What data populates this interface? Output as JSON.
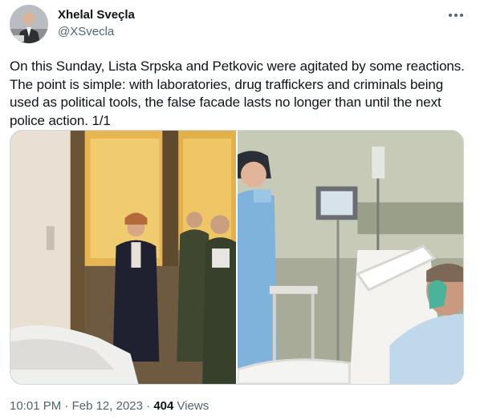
{
  "author": {
    "display_name": "Xhelal Sveçla",
    "handle": "@XSvecla",
    "avatar_icon": "profile-photo"
  },
  "more_icon": "more-horizontal-icon",
  "tweet": {
    "text": "On this Sunday, Lista Srpska and Petkovic were agitated by some reactions. The point is simple: with laboratories, drug traffickers and criminals being used as political tools, the false facade lasts no longer than until the next police action. 1/1"
  },
  "media": {
    "photos": [
      {
        "icon": "photo-visitors-by-hospital-bed"
      },
      {
        "icon": "photo-patient-in-hospital-bed"
      }
    ]
  },
  "meta": {
    "time": "10:01 PM",
    "separator": "·",
    "date": "Feb 12, 2023",
    "views_count": "404",
    "views_label": "Views"
  },
  "colors": {
    "text_primary": "#0f1419",
    "text_secondary": "#536471",
    "border": "#cfd9de"
  }
}
